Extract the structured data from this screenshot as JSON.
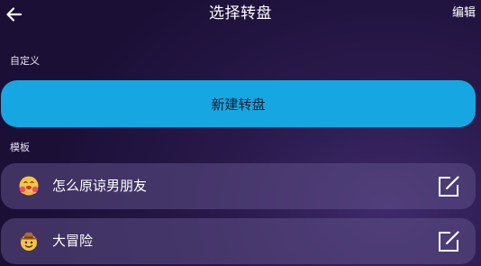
{
  "header": {
    "title": "选择转盘",
    "edit_label": "编辑",
    "back_icon": "arrow-left-icon"
  },
  "custom_section": {
    "label": "自定义",
    "new_wheel_label": "新建转盘",
    "button_color": "#16a7e3"
  },
  "template_section": {
    "label": "模板",
    "items": [
      {
        "label": "怎么原谅男朋友",
        "icon": "hugging-face-emoji",
        "action_icon": "edit-square-icon"
      },
      {
        "label": "大冒险",
        "icon": "cowboy-face-emoji",
        "action_icon": "edit-square-icon"
      }
    ]
  },
  "colors": {
    "background": "#2a1a4d",
    "accent": "#16a7e3",
    "card": "#5f5087"
  }
}
